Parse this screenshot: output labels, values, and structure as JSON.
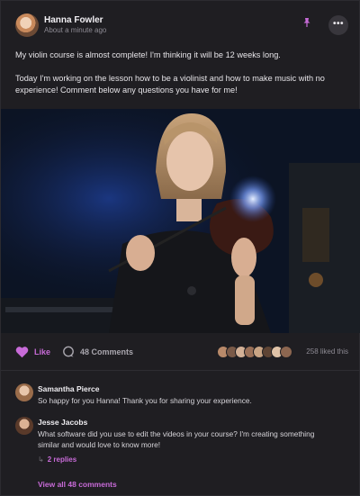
{
  "post": {
    "author": "Hanna Fowler",
    "timestamp": "About a minute ago",
    "more_label": "•••",
    "paragraphs": [
      "My violin course is almost complete! I'm thinking it will be 12 weeks long.",
      "Today I'm working on the lesson how to be a violinist and how to make music with no experience! Comment below any questions you have for me!"
    ]
  },
  "actions": {
    "like_label": "Like",
    "comments_label": "48 Comments",
    "liked_count": "258 liked this"
  },
  "comments": [
    {
      "author": "Samantha Pierce",
      "text": "So happy for you Hanna! Thank you for sharing your experience."
    },
    {
      "author": "Jesse Jacobs",
      "text": "What software did you use to edit the videos in your course? I'm creating something similar and would love to know more!",
      "replies_label": "2 replies"
    }
  ],
  "view_all_label": "View all 48 comments",
  "colors": {
    "accent": "#c86bd8",
    "background": "#1f1e22"
  }
}
